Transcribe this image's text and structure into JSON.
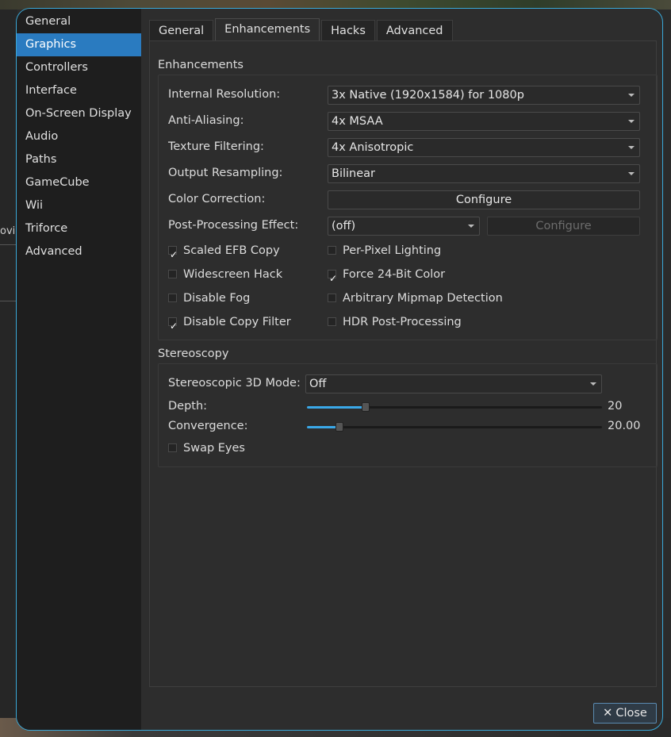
{
  "background": {
    "peek_text": "ovie"
  },
  "sidebar": {
    "items": [
      {
        "label": "General",
        "active": false
      },
      {
        "label": "Graphics",
        "active": true
      },
      {
        "label": "Controllers",
        "active": false
      },
      {
        "label": "Interface",
        "active": false
      },
      {
        "label": "On-Screen Display",
        "active": false
      },
      {
        "label": "Audio",
        "active": false
      },
      {
        "label": "Paths",
        "active": false
      },
      {
        "label": "GameCube",
        "active": false
      },
      {
        "label": "Wii",
        "active": false
      },
      {
        "label": "Triforce",
        "active": false
      },
      {
        "label": "Advanced",
        "active": false
      }
    ]
  },
  "tabs": [
    {
      "label": "General",
      "active": false
    },
    {
      "label": "Enhancements",
      "active": true
    },
    {
      "label": "Hacks",
      "active": false
    },
    {
      "label": "Advanced",
      "active": false
    }
  ],
  "enhancements": {
    "title": "Enhancements",
    "internal_resolution": {
      "label": "Internal Resolution:",
      "value": "3x Native (1920x1584) for 1080p"
    },
    "anti_aliasing": {
      "label": "Anti-Aliasing:",
      "value": "4x MSAA"
    },
    "texture_filtering": {
      "label": "Texture Filtering:",
      "value": "4x Anisotropic"
    },
    "output_resampling": {
      "label": "Output Resampling:",
      "value": "Bilinear"
    },
    "color_correction": {
      "label": "Color Correction:",
      "button": "Configure"
    },
    "post_processing": {
      "label": "Post-Processing Effect:",
      "value": "(off)",
      "button": "Configure"
    },
    "checkboxes": {
      "scaled_efb_copy": {
        "label": "Scaled EFB Copy",
        "checked": true
      },
      "per_pixel_lighting": {
        "label": "Per-Pixel Lighting",
        "checked": false
      },
      "widescreen_hack": {
        "label": "Widescreen Hack",
        "checked": false
      },
      "force_24bit_color": {
        "label": "Force 24-Bit Color",
        "checked": true
      },
      "disable_fog": {
        "label": "Disable Fog",
        "checked": false
      },
      "arbitrary_mipmap": {
        "label": "Arbitrary Mipmap Detection",
        "checked": false
      },
      "disable_copy_filter": {
        "label": "Disable Copy Filter",
        "checked": true
      },
      "hdr_post_processing": {
        "label": "HDR Post-Processing",
        "checked": false
      }
    }
  },
  "stereoscopy": {
    "title": "Stereoscopy",
    "mode": {
      "label": "Stereoscopic 3D Mode:",
      "value": "Off"
    },
    "depth": {
      "label": "Depth:",
      "value": "20",
      "fraction": 0.2
    },
    "convergence": {
      "label": "Convergence:",
      "value": "20.00",
      "fraction": 0.11
    },
    "swap_eyes": {
      "label": "Swap Eyes",
      "checked": false
    }
  },
  "footer": {
    "close_label": "Close",
    "close_icon": "close-icon"
  },
  "colors": {
    "accent": "#2a7bc0",
    "border_accent": "#3aa8d8",
    "slider_fill": "#3aa8e8"
  }
}
